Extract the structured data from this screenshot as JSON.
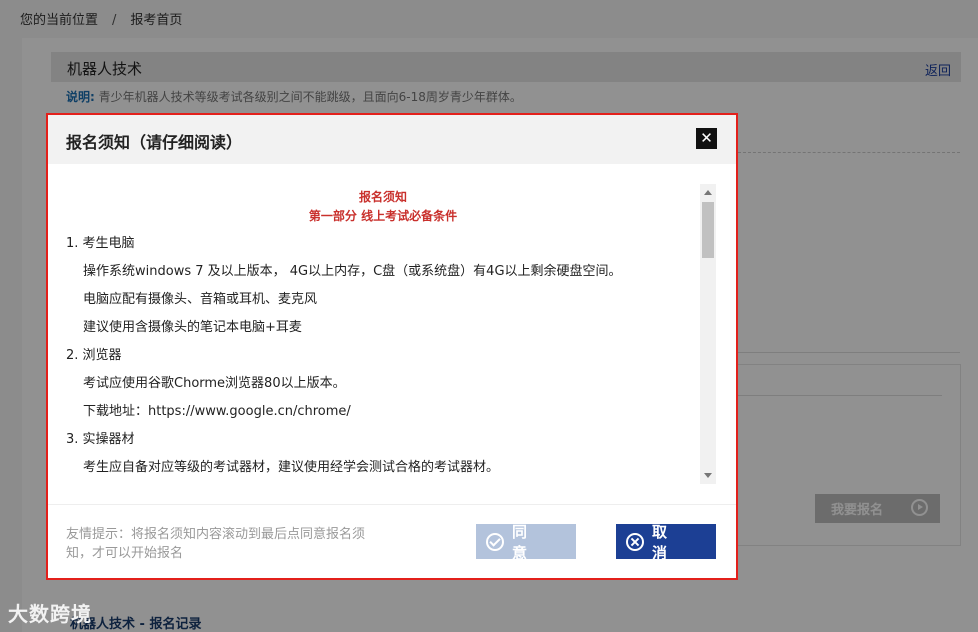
{
  "breadcrumb": {
    "current_position": "您的当前位置",
    "separator": "/",
    "page": "报考首页"
  },
  "section": {
    "title": "机器人技术",
    "back_label": "返回",
    "desc_label": "说明:",
    "desc_text": "青少年机器人技术等级考试各级别之间不能跳级，且面向6-18周岁青少年群体。"
  },
  "apply_button": {
    "label": "我要报名"
  },
  "records_title": "机器人技术 - 报名记录",
  "watermark": "大数跨境",
  "modal": {
    "title": "报名须知（请仔细阅读）",
    "close_label": "✕",
    "content": {
      "heading": "报名须知",
      "subheading": "第一部分 线上考试必备条件",
      "items": [
        {
          "title": "1.  考生电脑",
          "lines": [
            "操作系统windows 7 及以上版本， 4G以上内存，C盘（或系统盘）有4G以上剩余硬盘空间。",
            "电脑应配有摄像头、音箱或耳机、麦克风",
            "建议使用含摄像头的笔记本电脑+耳麦"
          ]
        },
        {
          "title": "2.  浏览器",
          "lines": [
            "考试应使用谷歌Chorme浏览器80以上版本。",
            "下载地址：https://www.google.cn/chrome/"
          ]
        },
        {
          "title": "3.  实操器材",
          "lines": [
            "考生应自备对应等级的考试器材，建议使用经学会测试合格的考试器材。"
          ]
        }
      ]
    },
    "hint": "友情提示：将报名须知内容滚动到最后点同意报名须知，才可以开始报名",
    "agree_label": "同 意",
    "cancel_label": "取 消"
  }
}
